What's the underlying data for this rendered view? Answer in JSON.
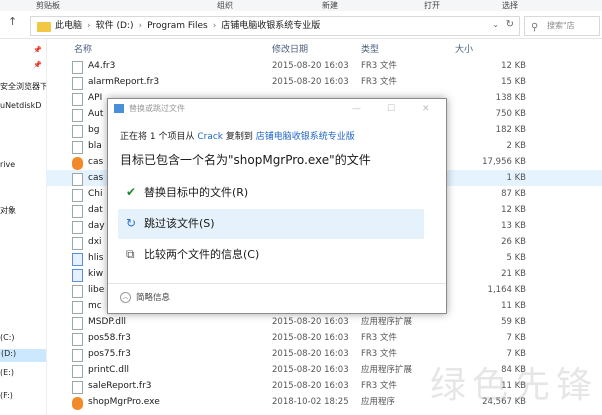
{
  "ribbon": {
    "clipboard": "剪贴板",
    "organize": "组织",
    "new": "新建",
    "open": "打开",
    "select": "选择"
  },
  "address": {
    "crumbs": [
      "此电脑",
      "软件 (D:)",
      "Program Files",
      "店铺电脑收银系统专业版"
    ],
    "search_placeholder": "搜索\"店"
  },
  "nav": [
    {
      "label": "安全浏览器下",
      "pinned": true
    },
    {
      "label": "uNetdiskD",
      "pinned": true
    },
    {
      "label": "rive",
      "pinned": false
    },
    {
      "label": "对象",
      "pinned": false
    },
    {
      "label": "(C:)",
      "pinned": false
    },
    {
      "label": "(D:)",
      "pinned": false,
      "selected": true
    },
    {
      "label": "(E:)",
      "pinned": false
    },
    {
      "label": "(F:)",
      "pinned": false
    }
  ],
  "columns": {
    "name": "名称",
    "date": "修改日期",
    "type": "类型",
    "size": "大小"
  },
  "files": [
    {
      "name": "A4.fr3",
      "date": "2015-08-20 16:03",
      "type": "FR3 文件",
      "size": "12 KB",
      "icon": "file-icon"
    },
    {
      "name": "alarmReport.fr3",
      "date": "2015-08-20 16:03",
      "type": "FR3 文件",
      "size": "15 KB",
      "icon": "file-icon"
    },
    {
      "name": "API",
      "date": "",
      "type": "",
      "size": "138 KB",
      "icon": "file-icon"
    },
    {
      "name": "Aut",
      "date": "",
      "type": "",
      "size": "750 KB",
      "icon": "file-icon"
    },
    {
      "name": "bg",
      "date": "",
      "type": "",
      "size": "182 KB",
      "icon": "file-icon"
    },
    {
      "name": "bla",
      "date": "",
      "type": "",
      "size": "2 KB",
      "icon": "file-icon"
    },
    {
      "name": "cas",
      "date": "",
      "type": "",
      "size": "17,956 KB",
      "icon": "orange-app-icon"
    },
    {
      "name": "cas",
      "date": "",
      "type": "",
      "size": "1 KB",
      "icon": "gear-file-icon",
      "selected": true
    },
    {
      "name": "Chi",
      "date": "",
      "type": "",
      "size": "87 KB",
      "icon": "file-icon"
    },
    {
      "name": "dat",
      "date": "",
      "type": "",
      "size": "12 KB",
      "icon": "file-icon"
    },
    {
      "name": "day",
      "date": "",
      "type": "",
      "size": "13 KB",
      "icon": "file-icon"
    },
    {
      "name": "dxi",
      "date": "",
      "type": "",
      "size": "26 KB",
      "icon": "file-icon"
    },
    {
      "name": "hlis",
      "date": "",
      "type": "",
      "size": "5 KB",
      "icon": "blue-file-icon"
    },
    {
      "name": "kiw",
      "date": "",
      "type": "",
      "size": "21 KB",
      "icon": "blue-file-icon"
    },
    {
      "name": "libe",
      "date": "",
      "type": "",
      "size": "1,164 KB",
      "icon": "file-icon"
    },
    {
      "name": "mc",
      "date": "",
      "type": "",
      "size": "11 KB",
      "icon": "file-icon"
    },
    {
      "name": "MSDP.dll",
      "date": "2015-08-20 16:03",
      "type": "应用程序扩展",
      "size": "59 KB",
      "icon": "file-icon"
    },
    {
      "name": "pos58.fr3",
      "date": "2015-08-20 16:03",
      "type": "FR3 文件",
      "size": "7 KB",
      "icon": "file-icon"
    },
    {
      "name": "pos75.fr3",
      "date": "2015-08-20 16:03",
      "type": "FR3 文件",
      "size": "7 KB",
      "icon": "file-icon"
    },
    {
      "name": "printC.dll",
      "date": "2015-08-20 16:03",
      "type": "应用程序扩展",
      "size": "84 KB",
      "icon": "file-icon"
    },
    {
      "name": "saleReport.fr3",
      "date": "2015-08-20 16:03",
      "type": "FR3 文件",
      "size": "11 KB",
      "icon": "file-icon"
    },
    {
      "name": "shopMgrPro.exe",
      "date": "2018-10-02 18:25",
      "type": "应用程序",
      "size": "24,567 KB",
      "icon": "orange-app-icon"
    }
  ],
  "dialog": {
    "title": "替换或跳过文件",
    "line1_prefix": "正在将 1 个项目从",
    "line1_from": "Crack",
    "line1_mid": "复制到",
    "line1_to": "店铺电脑收银系统专业版",
    "line2": "目标已包含一个名为\"shopMgrPro.exe\"的文件",
    "options": [
      {
        "label": "替换目标中的文件(R)",
        "icon": "checkmark-icon",
        "icon_glyph": "✔",
        "color": "#1e8a2e"
      },
      {
        "label": "跳过该文件(S)",
        "icon": "skip-icon",
        "icon_glyph": "↻",
        "color": "#2a6fd6"
      },
      {
        "label": "比较两个文件的信息(C)",
        "icon": "compare-icon",
        "icon_glyph": "⧉",
        "color": "#555555"
      }
    ],
    "more_label": "简略信息"
  },
  "watermark": "绿色先锋",
  "highlight_color": "#cc1f2b"
}
